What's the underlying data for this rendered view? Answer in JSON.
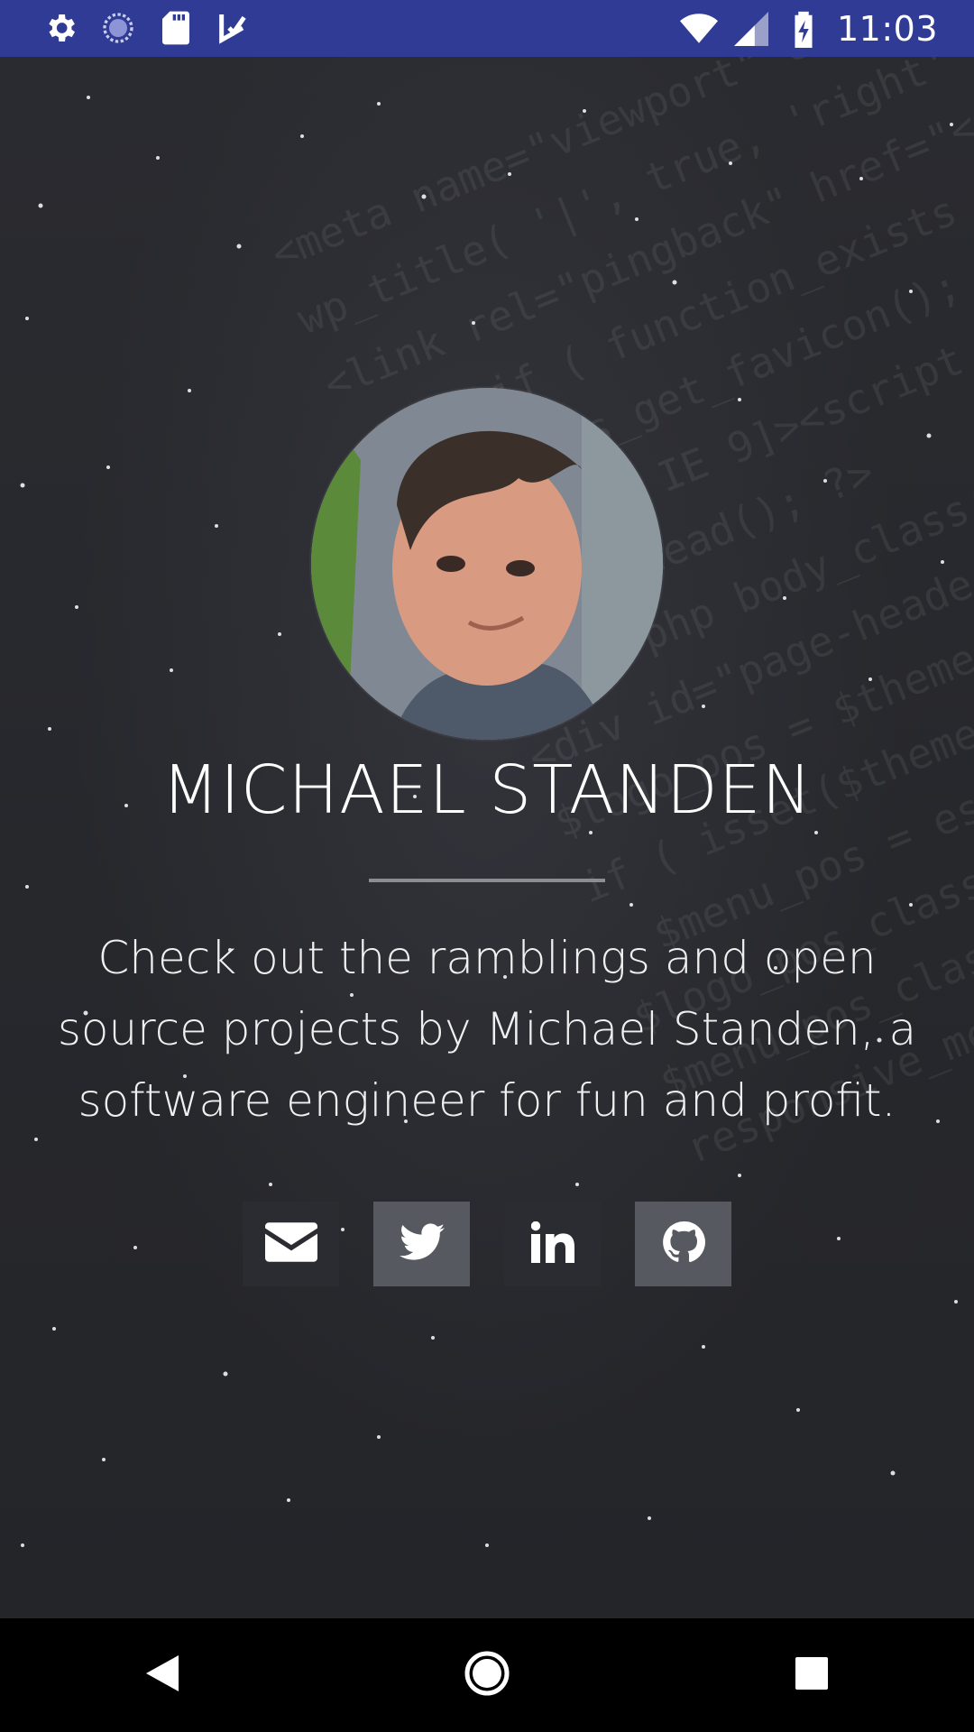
{
  "status_bar": {
    "time": "11:03",
    "left_icons": [
      "gear-icon",
      "sync-circle-icon",
      "sd-card-icon",
      "checkmark-arrow-icon"
    ],
    "right_icons": [
      "wifi-icon",
      "signal-icon",
      "battery-charging-icon"
    ]
  },
  "profile": {
    "name": "MICHAEL STANDEN",
    "tagline": "Check out the ramblings and open source projects by Michael Standen, a software engineer for fun and profit."
  },
  "social": [
    {
      "icon": "email-icon"
    },
    {
      "icon": "twitter-icon"
    },
    {
      "icon": "linkedin-icon"
    },
    {
      "icon": "github-icon"
    }
  ],
  "nav": [
    "back-icon",
    "home-icon",
    "recents-icon"
  ],
  "colors": {
    "status_bar": "#2f3b94",
    "background": "#26272b",
    "button_light": "#575960",
    "button_dark": "#2b2c31"
  }
}
